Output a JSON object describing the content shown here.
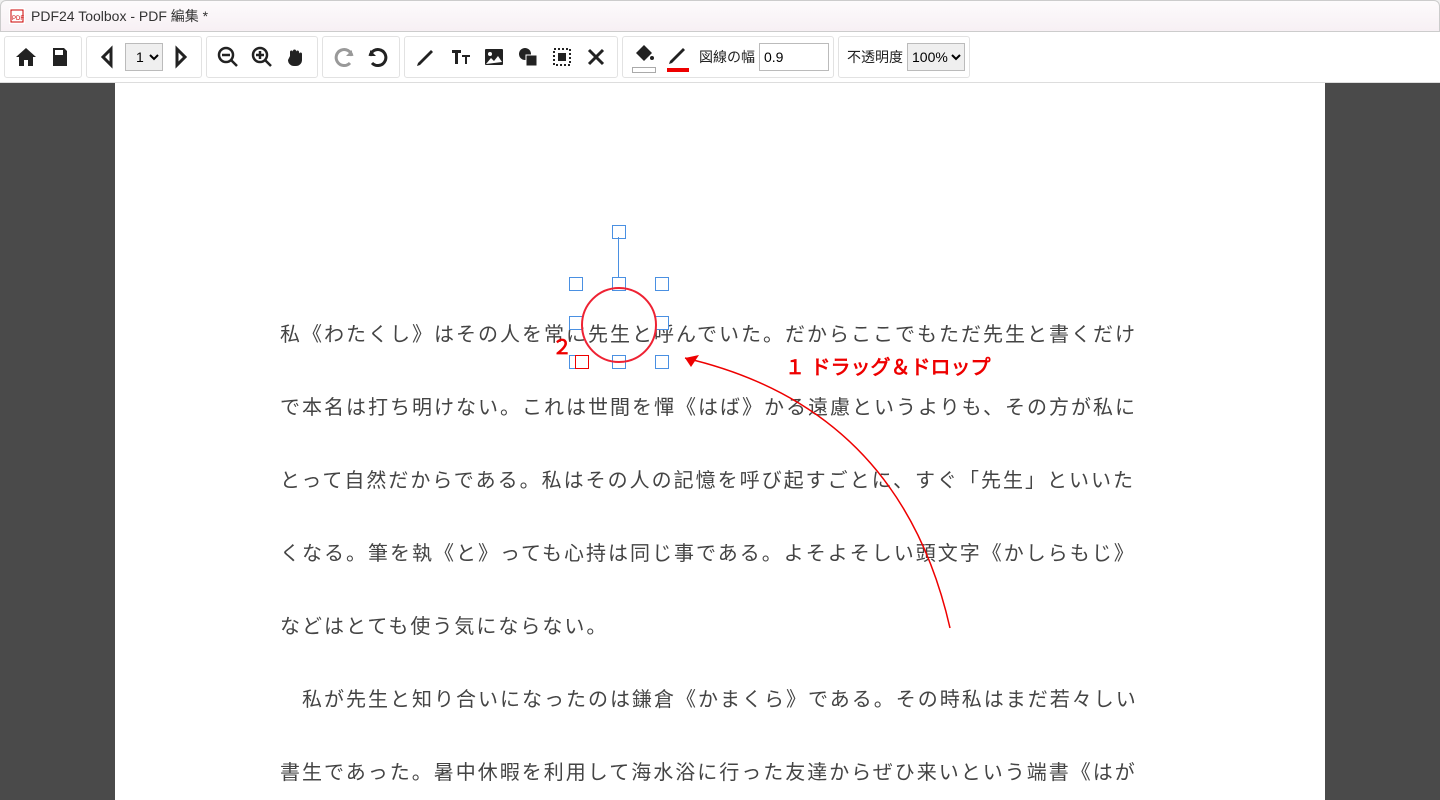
{
  "window": {
    "title": "PDF24 Toolbox - PDF 編集 *"
  },
  "toolbar": {
    "page_options": [
      "1"
    ],
    "page_value": "1",
    "line_width_label": "図線の幅",
    "line_width_value": "0.9",
    "opacity_label": "不透明度",
    "opacity_options": [
      "100%"
    ],
    "opacity_value": "100%",
    "fill_color": "#ffffff",
    "stroke_color": "#e60000"
  },
  "document": {
    "lines": [
      "私《わたくし》はその人を常に先生と呼んでいた。だからここでもただ先生と書くだけ",
      "で本名は打ち明けない。これは世間を憚《はば》かる遠慮というよりも、その方が私に",
      "とって自然だからである。私はその人の記憶を呼び起すごとに、すぐ「先生」といいた",
      "くなる。筆を執《と》っても心持は同じ事である。よそよそしい頭文字《かしらもじ》",
      "などはとても使う気にならない。",
      "　私が先生と知り合いになったのは鎌倉《かまくら》である。その時私はまだ若々しい",
      "書生であった。暑中休暇を利用して海水浴に行った友達からぜひ来いという端書《はが"
    ]
  },
  "annotations": {
    "label_2": "２",
    "label_1": "１ ドラッグ＆ドロップ"
  }
}
